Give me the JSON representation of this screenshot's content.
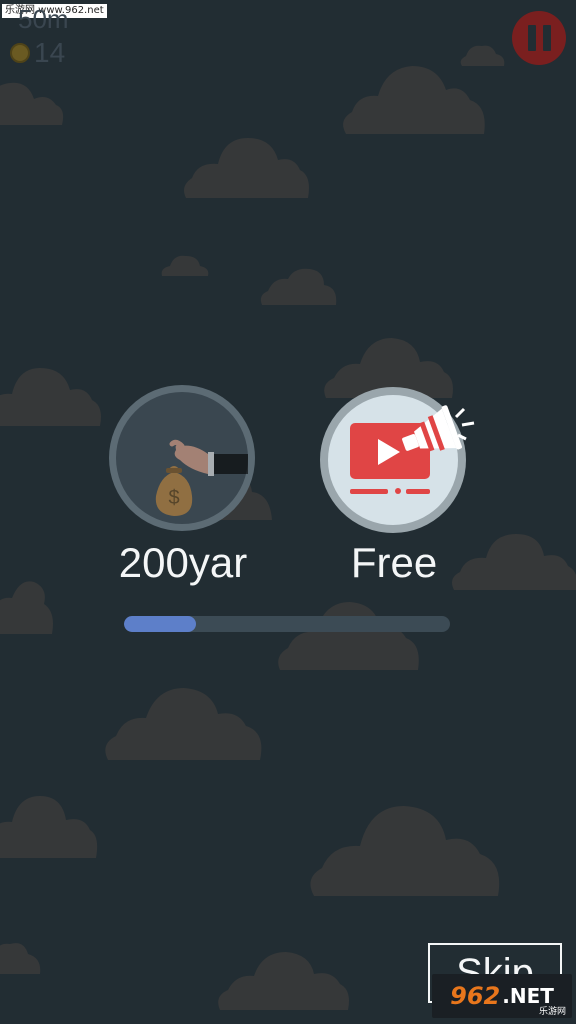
{
  "watermark": {
    "top_text": "乐游网 www.962.net",
    "bottom_number": "962",
    "bottom_suffix": ".NET",
    "bottom_sub": "乐游网"
  },
  "hud": {
    "distance": "50m",
    "coins": "14"
  },
  "options": {
    "buy": {
      "label": "200yar",
      "icon": "money-bag-hand-icon"
    },
    "free": {
      "label": "Free",
      "icon": "video-ad-megaphone-icon"
    }
  },
  "progress": {
    "fraction": 0.22
  },
  "skip": {
    "label": "Skip"
  },
  "colors": {
    "background": "#222d33",
    "cloud": "#363839",
    "pause": "#7a1f1f",
    "video_red": "#e04545",
    "progress_fill": "#5d7fc9"
  }
}
